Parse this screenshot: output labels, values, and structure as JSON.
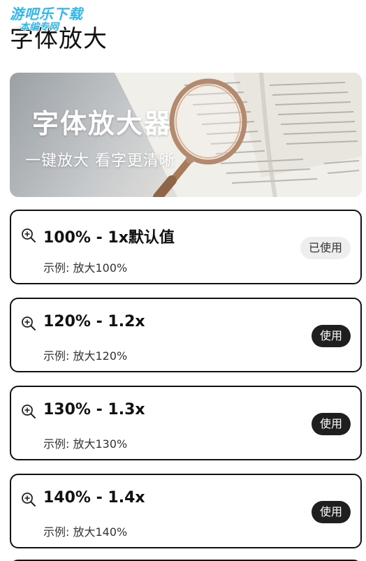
{
  "watermark": {
    "line1": "游吧乐下载",
    "line2": "本编专网"
  },
  "header": {
    "title": "字体放大"
  },
  "banner": {
    "title": "字体放大器",
    "subtitle": "一键放大 看字更清晰"
  },
  "options": [
    {
      "title": "100% - 1x默认值",
      "example": "示例: 放大100%",
      "button": "已使用",
      "state": "in-use"
    },
    {
      "title": "120% - 1.2x",
      "example": "示例: 放大120%",
      "button": "使用",
      "state": "available"
    },
    {
      "title": "130% - 1.3x",
      "example": "示例: 放大130%",
      "button": "使用",
      "state": "available"
    },
    {
      "title": "140% - 1.4x",
      "example": "示例: 放大140%",
      "button": "使用",
      "state": "available"
    }
  ],
  "icons": {
    "option_icon": "zoom-in-icon"
  },
  "colors": {
    "button_active_bg": "#1f1f1f",
    "button_in_use_bg": "#eeeeee",
    "card_border": "#111111",
    "watermark": "#2fb7f0"
  }
}
